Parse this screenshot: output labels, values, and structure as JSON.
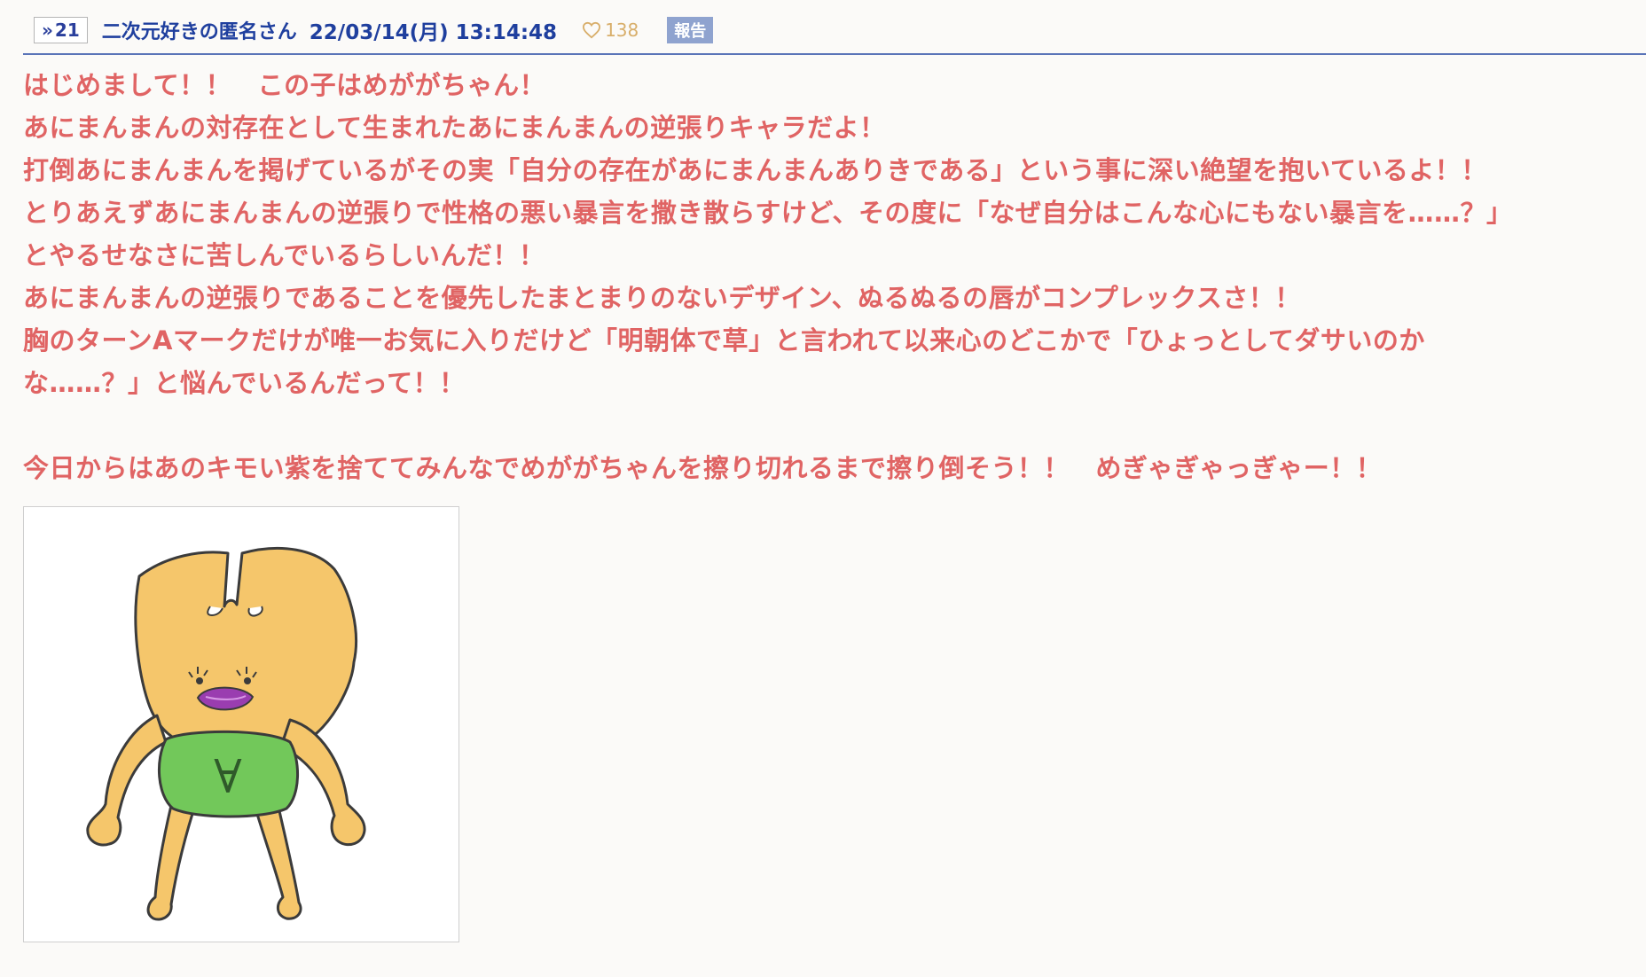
{
  "post": {
    "anchor_label": "21",
    "author_name": "二次元好きの匿名さん",
    "date": "22/03/14(月) 13:14:48",
    "like_count": "138",
    "report_label": "報告"
  },
  "body": {
    "lines": [
      "はじめまして！！　この子はめががちゃん！",
      "あにまんまんの対存在として生まれたあにまんまんの逆張りキャラだよ！",
      "打倒あにまんまんを掲げているがその実「自分の存在があにまんまんありきである」という事に深い絶望を抱いているよ！！",
      "とりあえずあにまんまんの逆張りで性格の悪い暴言を撒き散らすけど、その度に「なぜ自分はこんな心にもない暴言を……？」",
      "とやるせなさに苦しんでいるらしいんだ！！",
      "あにまんまんの逆張りであることを優先したまとまりのないデザイン、ぬるぬるの唇がコンプレックスさ！！",
      "胸のターンAマークだけが唯一お気に入りだけど「明朝体で草」と言われて以来心のどこかで「ひょっとしてダサいのか",
      "な……？」と悩んでいるんだって！！",
      "",
      "今日からはあのキモい紫を捨ててみんなでめががちゃんを擦り切れるまで擦り倒そう！！　めぎゃぎゃっぎゃー！！"
    ]
  },
  "image": {
    "shirt_mark": "∀"
  },
  "colors": {
    "body_text": "#e06464",
    "header_text": "#1f3f9e",
    "rule": "#5a74b8",
    "like": "#d8ae6a",
    "report_bg": "#8fa3cf",
    "character_body": "#f5c66b",
    "character_shirt": "#72c85a",
    "character_lips": "#9a3db0"
  }
}
